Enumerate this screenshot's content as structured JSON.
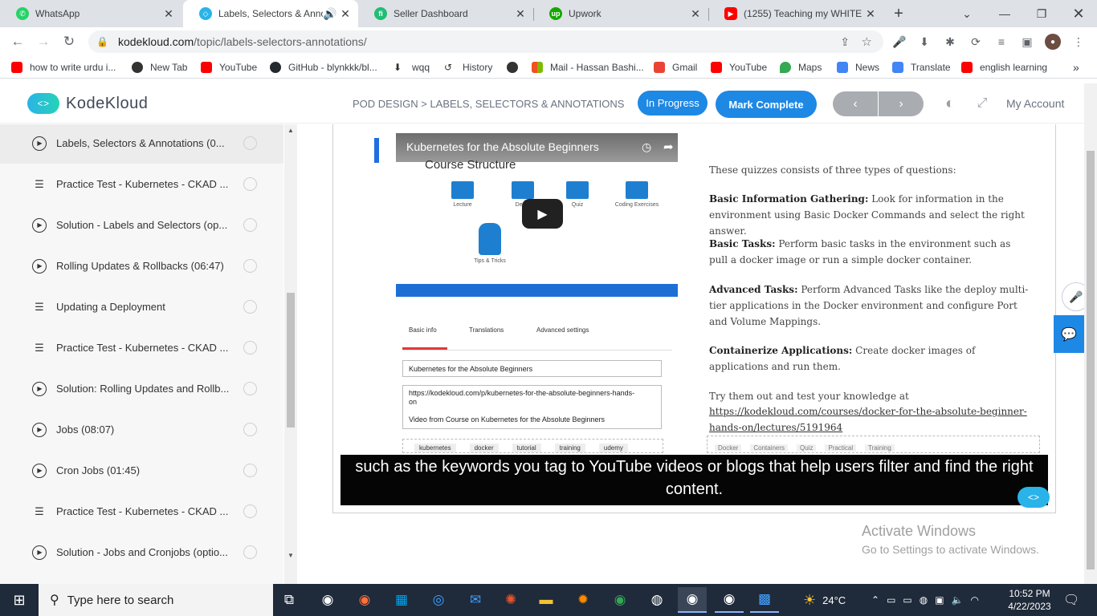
{
  "browser": {
    "tabs": [
      {
        "title": "WhatsApp",
        "icon": "whatsapp-icon",
        "color": "#25d366"
      },
      {
        "title": "Labels, Selectors & Anno",
        "icon": "kodekloud-icon",
        "color": "#2ab3e8",
        "active": true
      },
      {
        "title": "Seller Dashboard",
        "icon": "fiverr-icon",
        "color": "#1dbf73"
      },
      {
        "title": "Upwork",
        "icon": "upwork-icon",
        "color": "#14a800"
      },
      {
        "title": "(1255) Teaching my WHITE fr",
        "icon": "youtube-icon",
        "color": "#ff0000"
      }
    ],
    "url_host": "kodekloud.com",
    "url_path": "/topic/labels-selectors-annotations/",
    "bookmarks": [
      {
        "label": "how to write urdu i...",
        "icon": "youtube-icon",
        "color": "#ff0000"
      },
      {
        "label": "New Tab",
        "icon": "globe-icon",
        "color": "#333333"
      },
      {
        "label": "YouTube",
        "icon": "youtube-icon",
        "color": "#ff0000"
      },
      {
        "label": "GitHub - blynkkk/bl...",
        "icon": "github-icon",
        "color": "#24292e"
      },
      {
        "label": "wqq",
        "icon": "download-icon",
        "color": "#333333"
      },
      {
        "label": "History",
        "icon": "history-icon",
        "color": "#333333"
      },
      {
        "label": "",
        "icon": "globe-icon",
        "color": "#333333"
      },
      {
        "label": "Mail - Hassan Bashi...",
        "icon": "microsoft-icon",
        "color": "#f25022"
      },
      {
        "label": "Gmail",
        "icon": "gmail-icon",
        "color": "#ea4335"
      },
      {
        "label": "YouTube",
        "icon": "youtube-icon",
        "color": "#ff0000"
      },
      {
        "label": "Maps",
        "icon": "maps-icon",
        "color": "#34a853"
      },
      {
        "label": "News",
        "icon": "news-icon",
        "color": "#4285f4"
      },
      {
        "label": "Translate",
        "icon": "translate-icon",
        "color": "#4285f4"
      },
      {
        "label": "english learning",
        "icon": "youtube-icon",
        "color": "#ff0000"
      }
    ]
  },
  "header": {
    "logo": "KodeKloud",
    "breadcrumb": "POD DESIGN > LABELS, SELECTORS & ANNOTATIONS",
    "status_button": "In Progress",
    "complete_button": "Mark Complete",
    "account": "My Account"
  },
  "sidebar": {
    "items": [
      {
        "label": "Labels, Selectors & Annotations (0...",
        "type": "video",
        "selected": true
      },
      {
        "label": "Practice Test - Kubernetes - CKAD ...",
        "type": "quiz"
      },
      {
        "label": "Solution - Labels and Selectors (op...",
        "type": "video"
      },
      {
        "label": "Rolling Updates & Rollbacks (06:47)",
        "type": "video"
      },
      {
        "label": "Updating a Deployment",
        "type": "quiz"
      },
      {
        "label": "Practice Test - Kubernetes - CKAD ...",
        "type": "quiz"
      },
      {
        "label": "Solution: Rolling Updates and Rollb...",
        "type": "video"
      },
      {
        "label": "Jobs (08:07)",
        "type": "video"
      },
      {
        "label": "Cron Jobs (01:45)",
        "type": "video"
      },
      {
        "label": "Practice Test - Kubernetes - CKAD ...",
        "type": "quiz"
      },
      {
        "label": "Solution - Jobs and Cronjobs (optio...",
        "type": "video"
      }
    ]
  },
  "video": {
    "title": "Kubernetes for the Absolute Beginners",
    "slide_title": "Course Structure",
    "icons": [
      "Lecture",
      "Demo",
      "Quiz",
      "Coding Exercises",
      "Tips & Tricks"
    ],
    "tabs": [
      "Basic info",
      "Translations",
      "Advanced settings"
    ],
    "field_title": "Kubernetes for the Absolute Beginners",
    "field_desc_url": "https://kodekloud.com/p/kubernetes-for-the-absolute-beginners-hands-on",
    "field_desc_text": "Video from Course on Kubernetes for the Absolute Beginners",
    "tags": [
      "kubernetes",
      "docker",
      "tutorial",
      "training",
      "udemy"
    ]
  },
  "quiz": {
    "intro": "These quizzes consists of three types of questions:",
    "sections": [
      {
        "heading": "Basic Information Gathering:",
        "text": "Look for information in the environment using Basic Docker Commands and select the right answer."
      },
      {
        "heading": "Basic Tasks:",
        "text": "Perform basic tasks in the environment such as pull a docker image or run a simple docker container."
      },
      {
        "heading": "Advanced Tasks:",
        "text": "Perform Advanced Tasks like the deploy multi-tier applications in the Docker environment and configure Port and Volume Mappings."
      },
      {
        "heading": "Containerize Applications:",
        "text": "Create docker images of applications and run them."
      }
    ],
    "try_text": "Try them out and test your knowledge at",
    "link": "https://kodekloud.com/courses/docker-for-the-absolute-beginner-hands-on/lectures/5191964",
    "tags": [
      "Docker",
      "Containers",
      "Quiz",
      "Practical",
      "Training"
    ]
  },
  "caption": "such as the keywords you tag to YouTube videos or blogs that help users filter and find the right content.",
  "activation": {
    "line1": "Activate Windows",
    "line2": "Go to Settings to activate Windows."
  },
  "taskbar": {
    "search_placeholder": "Type here to search",
    "weather": "24°C",
    "time": "10:52 PM",
    "date": "4/22/2023"
  }
}
